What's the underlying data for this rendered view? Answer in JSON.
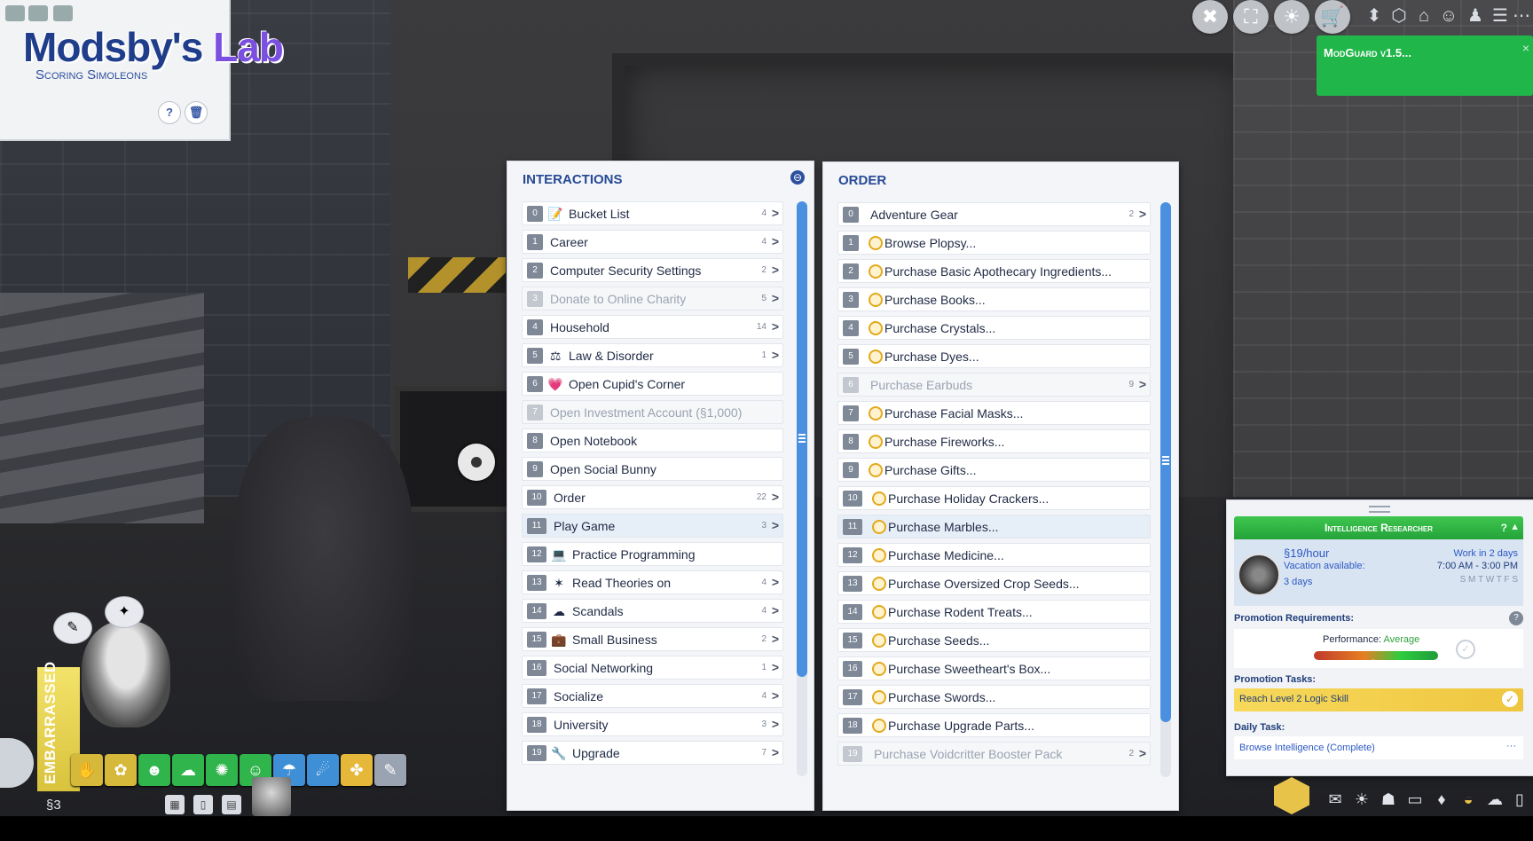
{
  "logo": {
    "title_main": "Modsby's",
    "title_accent": "Lab",
    "subtitle": "Scoring Simoleons",
    "help_label": "?",
    "trash_label": "🗑"
  },
  "modguard": {
    "title": "ModGuard v1.5...",
    "close": "×"
  },
  "topbar_icons": [
    "wrench-icon",
    "build-icon",
    "lightbulb-icon",
    "cart-icon",
    "camera-up-icon",
    "cube-icon",
    "house-icon",
    "person-icon",
    "sim-icon",
    "list-icon",
    "more-icon"
  ],
  "interactions": {
    "title": "INTERACTIONS",
    "header_icon": "⊖",
    "items": [
      {
        "num": "0",
        "label": "Bucket List",
        "count": "4",
        "arrow": ">",
        "icon": "📝"
      },
      {
        "num": "1",
        "label": "Career",
        "count": "4",
        "arrow": ">"
      },
      {
        "num": "2",
        "label": "Computer Security Settings",
        "count": "2",
        "arrow": ">"
      },
      {
        "num": "3",
        "label": "Donate to Online Charity",
        "count": "5",
        "arrow": ">",
        "disabled": true
      },
      {
        "num": "4",
        "label": "Household",
        "count": "14",
        "arrow": ">"
      },
      {
        "num": "5",
        "label": "Law & Disorder",
        "count": "1",
        "arrow": ">",
        "icon": "⚖"
      },
      {
        "num": "6",
        "label": "Open Cupid's Corner",
        "icon": "💗"
      },
      {
        "num": "7",
        "label": "Open Investment Account (§1,000)",
        "disabled": true
      },
      {
        "num": "8",
        "label": "Open Notebook"
      },
      {
        "num": "9",
        "label": "Open Social Bunny"
      },
      {
        "num": "10",
        "label": "Order",
        "count": "22",
        "arrow": ">"
      },
      {
        "num": "11",
        "label": "Play Game",
        "count": "3",
        "arrow": ">",
        "hover": true
      },
      {
        "num": "12",
        "label": "Practice Programming",
        "icon": "💻"
      },
      {
        "num": "13",
        "label": "Read Theories on",
        "count": "4",
        "arrow": ">",
        "icon": "✶"
      },
      {
        "num": "14",
        "label": "Scandals",
        "count": "4",
        "arrow": ">",
        "icon": "☁"
      },
      {
        "num": "15",
        "label": "Small Business",
        "count": "2",
        "arrow": ">",
        "icon": "💼"
      },
      {
        "num": "16",
        "label": "Social Networking",
        "count": "1",
        "arrow": ">"
      },
      {
        "num": "17",
        "label": "Socialize",
        "count": "4",
        "arrow": ">"
      },
      {
        "num": "18",
        "label": "University",
        "count": "3",
        "arrow": ">"
      },
      {
        "num": "19",
        "label": "Upgrade",
        "count": "7",
        "arrow": ">",
        "icon": "🔧"
      }
    ]
  },
  "order": {
    "title": "ORDER",
    "items": [
      {
        "num": "0",
        "label": "Adventure Gear",
        "count": "2",
        "arrow": ">"
      },
      {
        "num": "1",
        "label": "Browse Plopsy...",
        "coin": true
      },
      {
        "num": "2",
        "label": "Purchase Basic Apothecary Ingredients...",
        "coin": true
      },
      {
        "num": "3",
        "label": "Purchase Books...",
        "coin": true
      },
      {
        "num": "4",
        "label": "Purchase Crystals...",
        "coin": true
      },
      {
        "num": "5",
        "label": "Purchase Dyes...",
        "coin": true
      },
      {
        "num": "6",
        "label": "Purchase Earbuds",
        "count": "9",
        "arrow": ">",
        "disabled": true
      },
      {
        "num": "7",
        "label": "Purchase Facial Masks...",
        "coin": true
      },
      {
        "num": "8",
        "label": "Purchase Fireworks...",
        "coin": true
      },
      {
        "num": "9",
        "label": "Purchase Gifts...",
        "coin": true
      },
      {
        "num": "10",
        "label": "Purchase Holiday Crackers...",
        "coin": true
      },
      {
        "num": "11",
        "label": "Purchase Marbles...",
        "coin": true,
        "hover": true
      },
      {
        "num": "12",
        "label": "Purchase Medicine...",
        "coin": true
      },
      {
        "num": "13",
        "label": "Purchase Oversized Crop Seeds...",
        "coin": true
      },
      {
        "num": "14",
        "label": "Purchase Rodent Treats...",
        "coin": true
      },
      {
        "num": "15",
        "label": "Purchase Seeds...",
        "coin": true
      },
      {
        "num": "16",
        "label": "Purchase Sweetheart's Box...",
        "coin": true
      },
      {
        "num": "17",
        "label": "Purchase Swords...",
        "coin": true
      },
      {
        "num": "18",
        "label": "Purchase Upgrade Parts...",
        "coin": true
      },
      {
        "num": "19",
        "label": "Purchase Voidcritter Booster Pack",
        "count": "2",
        "arrow": ">",
        "disabled": true
      }
    ]
  },
  "career": {
    "title": "Intelligence Researcher",
    "help": "?",
    "wage": "§19/hour",
    "vacation": "Vacation available:",
    "vacation_days": "3 days",
    "work_in": "Work in 2 days",
    "hours": "7:00 AM - 3:00 PM",
    "days": "S M T W T F S",
    "promotion_requirements": "Promotion Requirements:",
    "performance_label": "Performance:",
    "performance_value": "Average",
    "performance_level": 0.48,
    "promotion_tasks": "Promotion Tasks:",
    "task_1": "Reach Level 2 Logic Skill",
    "daily_task": "Daily Task:",
    "daily_1": "Browse Intelligence (Complete)",
    "daily_more": "···"
  },
  "sim": {
    "mood": "EMBARRASSED",
    "funds": "§3"
  },
  "colors": {
    "accent_blue": "#274a96",
    "scroll_blue": "#4a8fe0",
    "career_green": "#25a33a",
    "task_yellow": "#efc640",
    "coin_gold": "#e3a91c"
  }
}
